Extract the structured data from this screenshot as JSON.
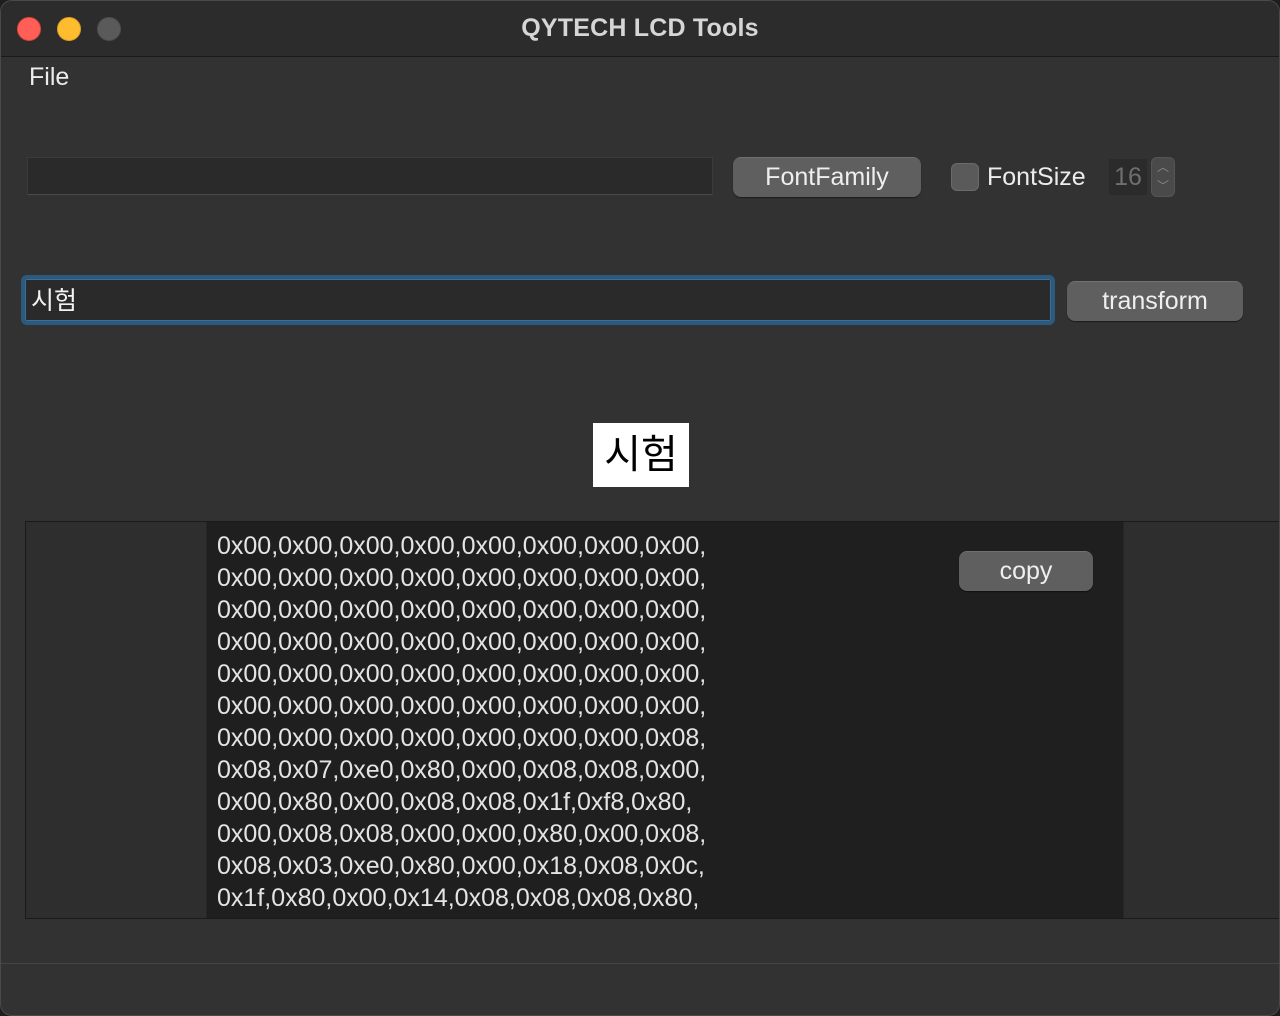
{
  "window": {
    "title": "QYTECH LCD Tools"
  },
  "menu": {
    "file": "File"
  },
  "toolbar": {
    "font_name_value": "",
    "font_family_label": "FontFamily",
    "font_size_label": "FontSize",
    "font_size_value": "16",
    "font_size_checked": false
  },
  "input": {
    "value": "시험",
    "transform_label": "transform"
  },
  "preview": {
    "text": "시험"
  },
  "output": {
    "copy_label": "copy",
    "lines": [
      "0x00,0x00,0x00,0x00,0x00,0x00,0x00,0x00,",
      "0x00,0x00,0x00,0x00,0x00,0x00,0x00,0x00,",
      "0x00,0x00,0x00,0x00,0x00,0x00,0x00,0x00,",
      "0x00,0x00,0x00,0x00,0x00,0x00,0x00,0x00,",
      "0x00,0x00,0x00,0x00,0x00,0x00,0x00,0x00,",
      "0x00,0x00,0x00,0x00,0x00,0x00,0x00,0x00,",
      "0x00,0x00,0x00,0x00,0x00,0x00,0x00,0x08,",
      "0x08,0x07,0xe0,0x80,0x00,0x08,0x08,0x00,",
      "0x00,0x80,0x00,0x08,0x08,0x1f,0xf8,0x80,",
      "0x00,0x08,0x08,0x00,0x00,0x80,0x00,0x08,",
      "0x08,0x03,0xe0,0x80,0x00,0x18,0x08,0x0c,",
      "0x1f,0x80,0x00,0x14,0x08,0x08,0x08,0x80,"
    ]
  }
}
